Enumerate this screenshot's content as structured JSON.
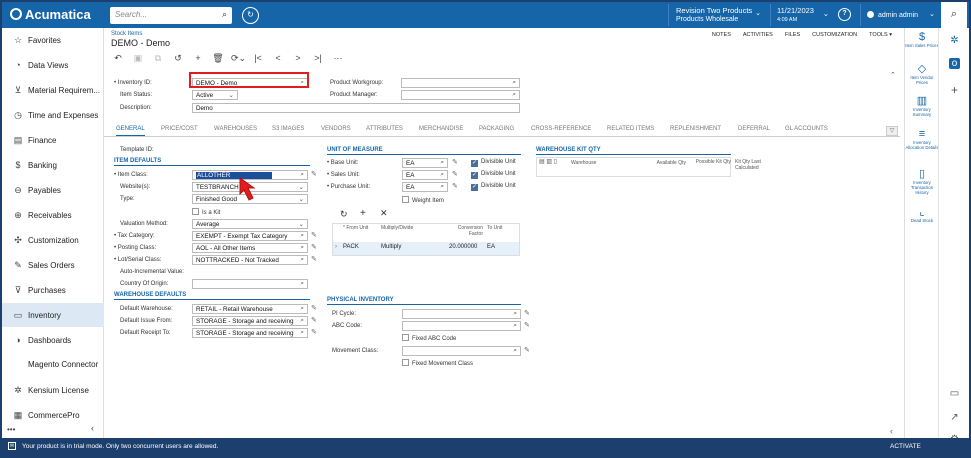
{
  "app": {
    "name": "Acumatica"
  },
  "topbar": {
    "search_placeholder": "Search...",
    "branch_line1": "Revision Two Products",
    "branch_line2": "Products Wholesale",
    "date": "11/21/2023",
    "time": "4:09 AM",
    "user": "admin admin",
    "help": "?"
  },
  "nav": {
    "items": [
      {
        "label": "Favorites",
        "icon": "star-icon",
        "glyph": "☆"
      },
      {
        "label": "Data Views",
        "icon": "data-views-icon",
        "glyph": "◔"
      },
      {
        "label": "Material Requirem...",
        "icon": "material-icon",
        "glyph": "⊻"
      },
      {
        "label": "Time and Expenses",
        "icon": "clock-icon",
        "glyph": "◷"
      },
      {
        "label": "Finance",
        "icon": "finance-icon",
        "glyph": "▤"
      },
      {
        "label": "Banking",
        "icon": "dollar-icon",
        "glyph": "$"
      },
      {
        "label": "Payables",
        "icon": "minus-circle-icon",
        "glyph": "⊖"
      },
      {
        "label": "Receivables",
        "icon": "plus-circle-icon",
        "glyph": "⊕"
      },
      {
        "label": "Customization",
        "icon": "puzzle-icon",
        "glyph": "✣"
      },
      {
        "label": "Sales Orders",
        "icon": "edit-icon",
        "glyph": "✎"
      },
      {
        "label": "Purchases",
        "icon": "cart-icon",
        "glyph": "⊽"
      },
      {
        "label": "Inventory",
        "icon": "truck-icon",
        "glyph": "▭"
      },
      {
        "label": "Dashboards",
        "icon": "dashboard-icon",
        "glyph": "◑"
      },
      {
        "label": "Magento Connector",
        "icon": "",
        "glyph": ""
      },
      {
        "label": "Kensium License",
        "icon": "kensium-icon",
        "glyph": "✲"
      },
      {
        "label": "CommercePro",
        "icon": "commercepro-icon",
        "glyph": "▦"
      }
    ],
    "more": "•••",
    "collapse": "‹"
  },
  "page": {
    "breadcrumb": "Stock Items",
    "title": "DEMO - Demo",
    "right_tools": [
      "NOTES",
      "ACTIVITIES",
      "FILES",
      "CUSTOMIZATION",
      "TOOLS ▾"
    ]
  },
  "header_form": {
    "inventory_id_label": "Inventory ID:",
    "inventory_id": "DEMO - Demo",
    "item_status_label": "Item Status:",
    "item_status": "Active",
    "description_label": "Description:",
    "description": "Demo",
    "product_workgroup_label": "Product Workgroup:",
    "product_manager_label": "Product Manager:"
  },
  "tabs": [
    "GENERAL",
    "PRICE/COST",
    "WAREHOUSES",
    "S3 IMAGES",
    "VENDORS",
    "ATTRIBUTES",
    "MERCHANDISE",
    "PACKAGING",
    "CROSS-REFERENCE",
    "RELATED ITEMS",
    "REPLENISHMENT",
    "DEFERRAL",
    "GL ACCOUNTS"
  ],
  "general": {
    "template_id_label": "Template ID:",
    "item_defaults_title": "ITEM DEFAULTS",
    "item_class_label": "Item Class:",
    "item_class": "ALLOTHER",
    "websites_label": "Website(s):",
    "websites": "TESTBRANCH",
    "type_label": "Type:",
    "type": "Finished Good",
    "is_kit": "Is a Kit",
    "valuation_label": "Valuation Method:",
    "valuation": "Average",
    "tax_cat_label": "Tax Category:",
    "tax_cat": "EXEMPT - Exempt Tax Category",
    "posting_class_label": "Posting Class:",
    "posting_class": "AOL - All Other Items",
    "lot_serial_label": "Lot/Serial Class:",
    "lot_serial": "NOTTRACKED - Not Tracked",
    "auto_inc_label": "Auto-Incremental Value:",
    "country_label": "Country Of Origin:",
    "warehouse_defaults_title": "WAREHOUSE DEFAULTS",
    "default_wh_label": "Default Warehouse:",
    "default_wh": "RETAIL - Retail Warehouse",
    "default_issue_label": "Default Issue From:",
    "default_issue": "STORAGE - Storage and receiving",
    "default_receipt_label": "Default Receipt To:",
    "default_receipt": "STORAGE - Storage and receiving"
  },
  "uom": {
    "title": "UNIT OF MEASURE",
    "base_label": "Base Unit:",
    "base": "EA",
    "sales_label": "Sales Unit:",
    "sales": "EA",
    "purchase_label": "Purchase Unit:",
    "purchase": "EA",
    "divisible": "Divisible Unit",
    "weight_item": "Weight Item",
    "grid_headers": [
      "* From Unit",
      "Multiply/Divide",
      "Conversion Factor",
      "To Unit"
    ],
    "grid_row": [
      "PACK",
      "Multiply",
      "20.000000",
      "EA"
    ]
  },
  "physical": {
    "title": "PHYSICAL INVENTORY",
    "pi_cycle_label": "PI Cycle:",
    "abc_label": "ABC Code:",
    "fixed_abc": "Fixed ABC Code",
    "movement_label": "Movement Class:",
    "fixed_movement": "Fixed Movement Class"
  },
  "warehouse_kit": {
    "title": "WAREHOUSE KIT QTY",
    "headers": [
      "Warehouse",
      "Available Qty",
      "Possible Kit Qty",
      "Kit Qty Last Calculated"
    ]
  },
  "right_sidebar": [
    {
      "label": "Item Sales Prices",
      "icon": "dollar-icon",
      "glyph": "$"
    },
    {
      "label": "Item Vendor Prices",
      "icon": "tag-icon",
      "glyph": "◇"
    },
    {
      "label": "Inventory Summary",
      "icon": "summary-icon",
      "glyph": "▥"
    },
    {
      "label": "Inventory Allocation Details",
      "icon": "allocation-icon",
      "glyph": "≡"
    },
    {
      "label": "Inventory Transaction History",
      "icon": "history-icon",
      "glyph": "▯"
    },
    {
      "label": "Dead Stock",
      "icon": "chart-icon",
      "glyph": "⌞"
    }
  ],
  "bottom": {
    "trial": "Your product is in trial mode. Only two concurrent users are allowed.",
    "activate": "ACTIVATE"
  },
  "colors": {
    "brand": "#1565a8",
    "highlight": "#e21d1d",
    "selection": "#1d4e9c"
  }
}
